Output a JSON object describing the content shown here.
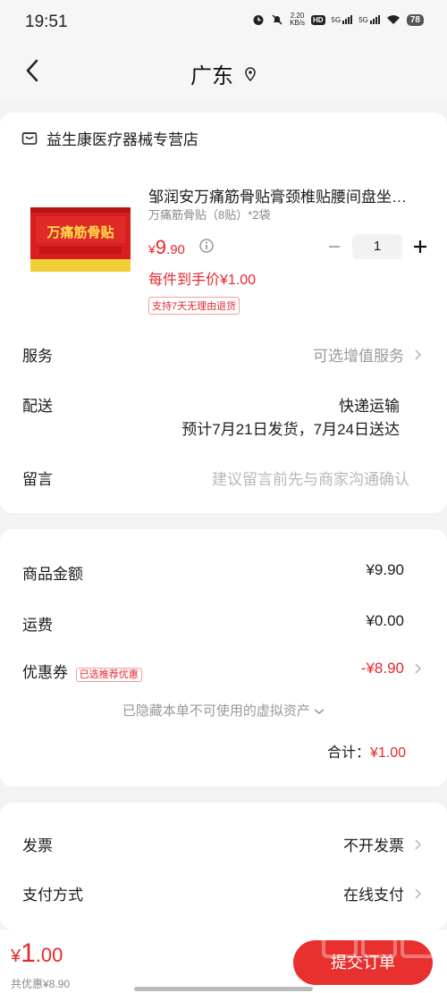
{
  "status": {
    "time": "19:51",
    "speed_value": "2.20",
    "speed_unit": "KB/s",
    "hd": "HD",
    "net1": "5G",
    "net2": "5G",
    "battery": "78"
  },
  "nav": {
    "title": "广东"
  },
  "store": {
    "name": "益生康医疗器械专营店"
  },
  "product": {
    "title": "邹润安万痛筋骨贴膏颈椎贴腰间盘坐…",
    "spec": "万痛筋骨贴（8贴）*2袋",
    "price_currency": "¥",
    "price_int": "9",
    "price_dec": ".90",
    "quantity": "1",
    "unit_price": "每件到手价¥1.00",
    "return_tag": "支持7天无理由退货",
    "image_text": "万痛筋骨贴"
  },
  "rows": {
    "service_label": "服务",
    "service_value": "可选增值服务",
    "delivery_label": "配送",
    "delivery_method": "快递运输",
    "delivery_schedule": "预计7月21日发货，7月24日送达",
    "message_label": "留言",
    "message_placeholder": "建议留言前先与商家沟通确认"
  },
  "summary": {
    "goods_label": "商品金额",
    "goods_value": "¥9.90",
    "shipping_label": "运费",
    "shipping_value": "¥0.00",
    "coupon_label": "优惠券",
    "coupon_tag": "已选推荐优惠",
    "coupon_value": "-¥8.90",
    "hidden_assets": "已隐藏本单不可使用的虚拟资产",
    "total_label": "合计：",
    "total_value": "¥1.00"
  },
  "invoice": {
    "invoice_label": "发票",
    "invoice_value": "不开发票",
    "pay_label": "支付方式",
    "pay_value": "在线支付"
  },
  "bottom": {
    "price_currency": "¥",
    "price_int": "1",
    "price_dec": ".00",
    "saved": "共优惠¥8.90",
    "submit": "提交订单"
  },
  "colors": {
    "accent": "#e4282e",
    "button": "#e8312e",
    "background": "#f3f3f3"
  }
}
